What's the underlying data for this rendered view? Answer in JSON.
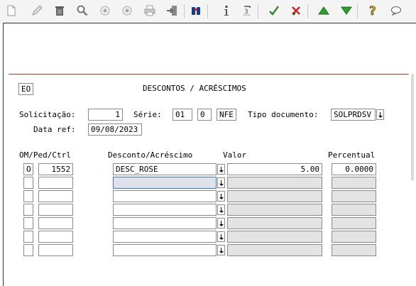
{
  "toolbar": {
    "icons": [
      "new-icon",
      "edit-icon",
      "trash-icon",
      "search-icon",
      "circle-prev-icon",
      "circle-next-icon",
      "print-icon",
      "exit-icon",
      "binoculars-icon",
      "info-icon",
      "sum-icon",
      "confirm-check-icon",
      "cancel-x-icon",
      "arrow-up-icon",
      "arrow-down-icon",
      "help-icon",
      "comment-icon"
    ],
    "colors": {
      "check": "#2e8b2e",
      "cancel": "#cc2222",
      "arrow_up": "#2aa02a",
      "arrow_down": "#2aa02a",
      "help": "#e0b000"
    }
  },
  "header": {
    "code": "EO",
    "title": "DESCONTOS / ACRÉSCIMOS"
  },
  "form": {
    "solicitacao_label": "Solicitação:",
    "solicitacao_value": "1",
    "serie_label": "Série:",
    "serie_value1": "01",
    "serie_value2": "0",
    "serie_value3": "NFE",
    "tipo_label": "Tipo documento:",
    "tipo_value": "SOLPRDSV",
    "data_label": "Data ref:",
    "data_value": "09/08/2023"
  },
  "table": {
    "headers": {
      "om_ped_ctrl": "OM/Ped/Ctrl",
      "desconto": "Desconto/Acréscimo",
      "valor": "Valor",
      "percentual": "Percentual"
    },
    "rows": [
      {
        "om": "O",
        "ped": "1552",
        "desconto": "DESC_ROSE",
        "valor": "5.00",
        "percentual": "0.0000"
      },
      {
        "om": "",
        "ped": "",
        "desconto": "",
        "valor": "",
        "percentual": ""
      },
      {
        "om": "",
        "ped": "",
        "desconto": "",
        "valor": "",
        "percentual": ""
      },
      {
        "om": "",
        "ped": "",
        "desconto": "",
        "valor": "",
        "percentual": ""
      },
      {
        "om": "",
        "ped": "",
        "desconto": "",
        "valor": "",
        "percentual": ""
      },
      {
        "om": "",
        "ped": "",
        "desconto": "",
        "valor": "",
        "percentual": ""
      },
      {
        "om": "",
        "ped": "",
        "desconto": "",
        "valor": "",
        "percentual": ""
      }
    ]
  }
}
